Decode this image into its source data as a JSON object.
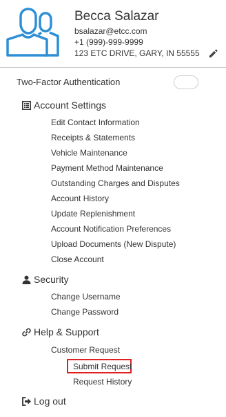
{
  "profile": {
    "name": "Becca Salazar",
    "email": "bsalazar@etcc.com",
    "phone": "+1 (999)-999-9999",
    "address": "123 ETC DRIVE, GARY, IN 55555"
  },
  "two_factor": {
    "label": "Two-Factor Authentication",
    "enabled": false
  },
  "account_settings": {
    "title": "Account Settings",
    "items": [
      "Edit Contact Information",
      "Receipts & Statements",
      "Vehicle Maintenance",
      "Payment Method Maintenance",
      "Outstanding Charges and Disputes",
      "Account History",
      "Update Replenishment",
      "Account Notification Preferences",
      "Upload Documents (New Dispute)",
      "Close Account"
    ]
  },
  "security": {
    "title": "Security",
    "items": [
      "Change Username",
      "Change Password"
    ]
  },
  "help_support": {
    "title": "Help & Support",
    "customer_request": "Customer Request",
    "sub_items": [
      "Submit Request",
      "Request History"
    ]
  },
  "logout": {
    "label": "Log out"
  },
  "colors": {
    "accent": "#2d8fd5",
    "highlight": "#e02020"
  },
  "icons": {
    "avatar": "users-icon",
    "edit": "pencil-icon",
    "account_settings": "list-icon",
    "security": "user-icon",
    "help_support": "link-icon",
    "logout": "sign-out-icon"
  }
}
